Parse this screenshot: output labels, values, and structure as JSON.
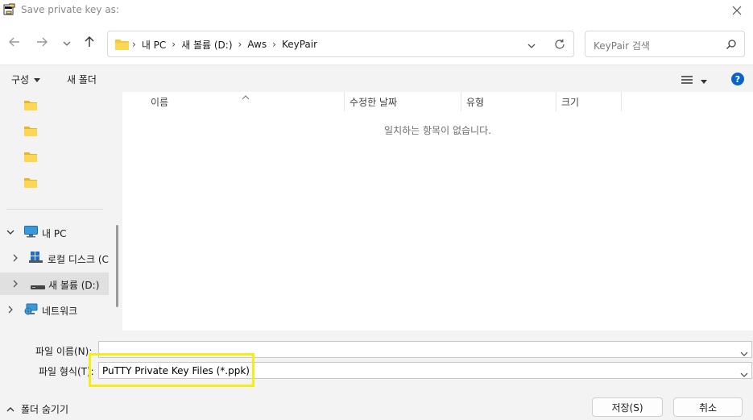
{
  "window": {
    "title": "Save private key as:",
    "close_symbol": "✕"
  },
  "nav": {
    "back_icon": "back-arrow-icon",
    "forward_icon": "forward-arrow-icon",
    "recent_icon": "chevron-down-icon",
    "up_icon": "up-arrow-icon"
  },
  "address": {
    "crumbs": [
      "내 PC",
      "새 볼륨 (D:)",
      "Aws",
      "KeyPair"
    ],
    "separator": "›"
  },
  "search": {
    "placeholder": "KeyPair 검색"
  },
  "toolbar": {
    "organize_label": "구성",
    "new_folder_label": "새 폴더",
    "help_label": "?"
  },
  "sidebar": {
    "items": [
      {
        "label": "내 PC",
        "icon": "computer-icon",
        "chevron": "down"
      },
      {
        "label": "로컬 디스크 (C",
        "icon": "windows-drive-icon",
        "chevron": "right"
      },
      {
        "label": "새 볼륨 (D:)",
        "icon": "drive-icon",
        "chevron": "right",
        "selected": true
      },
      {
        "label": "네트워크",
        "icon": "network-icon",
        "chevron": "right"
      }
    ]
  },
  "filelist": {
    "columns": [
      "이름",
      "수정한 날짜",
      "유형",
      "크기"
    ],
    "empty_message": "일치하는 항목이 없습니다."
  },
  "bottom": {
    "filename_label": "파일 이름(N):",
    "filename_value": "",
    "filetype_label": "파일 형식(T):",
    "filetype_value": "PuTTY Private Key Files (*.ppk)",
    "hide_folders_label": "폴더 숨기기",
    "save_label": "저장(S)",
    "cancel_label": "취소"
  },
  "colors": {
    "highlight": "#f5ee16",
    "folder": "#f8c82e",
    "help": "#0a64c8"
  }
}
